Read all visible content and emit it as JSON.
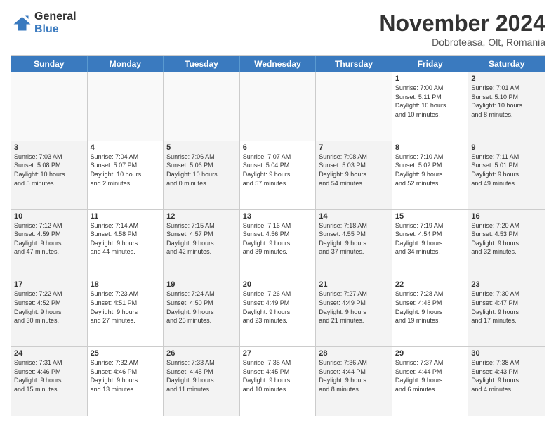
{
  "header": {
    "logo_general": "General",
    "logo_blue": "Blue",
    "month_title": "November 2024",
    "location": "Dobroteasa, Olt, Romania"
  },
  "weekdays": [
    "Sunday",
    "Monday",
    "Tuesday",
    "Wednesday",
    "Thursday",
    "Friday",
    "Saturday"
  ],
  "weeks": [
    [
      {
        "day": "",
        "info": "",
        "empty": true
      },
      {
        "day": "",
        "info": "",
        "empty": true
      },
      {
        "day": "",
        "info": "",
        "empty": true
      },
      {
        "day": "",
        "info": "",
        "empty": true
      },
      {
        "day": "",
        "info": "",
        "empty": true
      },
      {
        "day": "1",
        "info": "Sunrise: 7:00 AM\nSunset: 5:11 PM\nDaylight: 10 hours\nand 10 minutes."
      },
      {
        "day": "2",
        "info": "Sunrise: 7:01 AM\nSunset: 5:10 PM\nDaylight: 10 hours\nand 8 minutes."
      }
    ],
    [
      {
        "day": "3",
        "info": "Sunrise: 7:03 AM\nSunset: 5:08 PM\nDaylight: 10 hours\nand 5 minutes."
      },
      {
        "day": "4",
        "info": "Sunrise: 7:04 AM\nSunset: 5:07 PM\nDaylight: 10 hours\nand 2 minutes."
      },
      {
        "day": "5",
        "info": "Sunrise: 7:06 AM\nSunset: 5:06 PM\nDaylight: 10 hours\nand 0 minutes."
      },
      {
        "day": "6",
        "info": "Sunrise: 7:07 AM\nSunset: 5:04 PM\nDaylight: 9 hours\nand 57 minutes."
      },
      {
        "day": "7",
        "info": "Sunrise: 7:08 AM\nSunset: 5:03 PM\nDaylight: 9 hours\nand 54 minutes."
      },
      {
        "day": "8",
        "info": "Sunrise: 7:10 AM\nSunset: 5:02 PM\nDaylight: 9 hours\nand 52 minutes."
      },
      {
        "day": "9",
        "info": "Sunrise: 7:11 AM\nSunset: 5:01 PM\nDaylight: 9 hours\nand 49 minutes."
      }
    ],
    [
      {
        "day": "10",
        "info": "Sunrise: 7:12 AM\nSunset: 4:59 PM\nDaylight: 9 hours\nand 47 minutes."
      },
      {
        "day": "11",
        "info": "Sunrise: 7:14 AM\nSunset: 4:58 PM\nDaylight: 9 hours\nand 44 minutes."
      },
      {
        "day": "12",
        "info": "Sunrise: 7:15 AM\nSunset: 4:57 PM\nDaylight: 9 hours\nand 42 minutes."
      },
      {
        "day": "13",
        "info": "Sunrise: 7:16 AM\nSunset: 4:56 PM\nDaylight: 9 hours\nand 39 minutes."
      },
      {
        "day": "14",
        "info": "Sunrise: 7:18 AM\nSunset: 4:55 PM\nDaylight: 9 hours\nand 37 minutes."
      },
      {
        "day": "15",
        "info": "Sunrise: 7:19 AM\nSunset: 4:54 PM\nDaylight: 9 hours\nand 34 minutes."
      },
      {
        "day": "16",
        "info": "Sunrise: 7:20 AM\nSunset: 4:53 PM\nDaylight: 9 hours\nand 32 minutes."
      }
    ],
    [
      {
        "day": "17",
        "info": "Sunrise: 7:22 AM\nSunset: 4:52 PM\nDaylight: 9 hours\nand 30 minutes."
      },
      {
        "day": "18",
        "info": "Sunrise: 7:23 AM\nSunset: 4:51 PM\nDaylight: 9 hours\nand 27 minutes."
      },
      {
        "day": "19",
        "info": "Sunrise: 7:24 AM\nSunset: 4:50 PM\nDaylight: 9 hours\nand 25 minutes."
      },
      {
        "day": "20",
        "info": "Sunrise: 7:26 AM\nSunset: 4:49 PM\nDaylight: 9 hours\nand 23 minutes."
      },
      {
        "day": "21",
        "info": "Sunrise: 7:27 AM\nSunset: 4:49 PM\nDaylight: 9 hours\nand 21 minutes."
      },
      {
        "day": "22",
        "info": "Sunrise: 7:28 AM\nSunset: 4:48 PM\nDaylight: 9 hours\nand 19 minutes."
      },
      {
        "day": "23",
        "info": "Sunrise: 7:30 AM\nSunset: 4:47 PM\nDaylight: 9 hours\nand 17 minutes."
      }
    ],
    [
      {
        "day": "24",
        "info": "Sunrise: 7:31 AM\nSunset: 4:46 PM\nDaylight: 9 hours\nand 15 minutes."
      },
      {
        "day": "25",
        "info": "Sunrise: 7:32 AM\nSunset: 4:46 PM\nDaylight: 9 hours\nand 13 minutes."
      },
      {
        "day": "26",
        "info": "Sunrise: 7:33 AM\nSunset: 4:45 PM\nDaylight: 9 hours\nand 11 minutes."
      },
      {
        "day": "27",
        "info": "Sunrise: 7:35 AM\nSunset: 4:45 PM\nDaylight: 9 hours\nand 10 minutes."
      },
      {
        "day": "28",
        "info": "Sunrise: 7:36 AM\nSunset: 4:44 PM\nDaylight: 9 hours\nand 8 minutes."
      },
      {
        "day": "29",
        "info": "Sunrise: 7:37 AM\nSunset: 4:44 PM\nDaylight: 9 hours\nand 6 minutes."
      },
      {
        "day": "30",
        "info": "Sunrise: 7:38 AM\nSunset: 4:43 PM\nDaylight: 9 hours\nand 4 minutes."
      }
    ]
  ]
}
